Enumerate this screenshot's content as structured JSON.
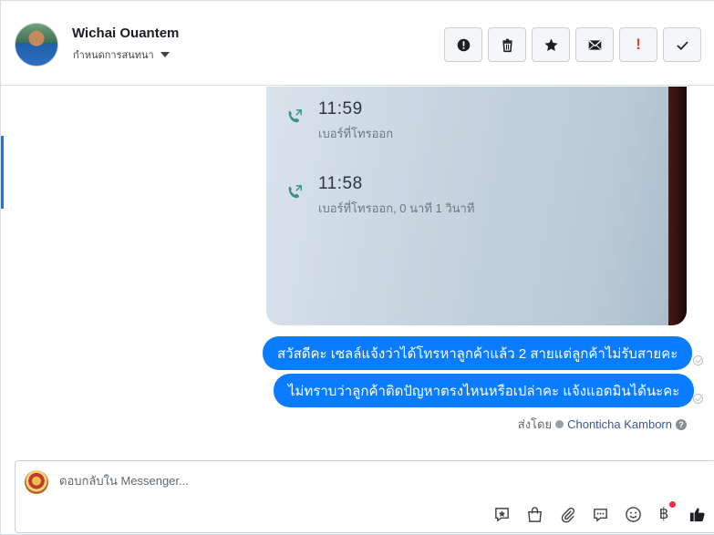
{
  "header": {
    "contact_name": "Wichai Ouantem",
    "assign_label": "กำหนดการสนทนา",
    "toolbar": {
      "spam_icon": "alert-circle-icon",
      "delete_icon": "trash-icon",
      "star_icon": "star-icon",
      "mail_icon": "envelope-icon",
      "important_label": "!",
      "done_icon": "check-icon"
    }
  },
  "photo": {
    "calls": [
      {
        "time": "11:59",
        "desc": "เบอร์ที่โทรออก"
      },
      {
        "time": "11:58",
        "desc": "เบอร์ที่โทรออก, 0 นาที 1 วินาที"
      }
    ]
  },
  "messages": [
    {
      "text": "สวัสดีคะ เซลล์แจ้งว่าได้โทรหาลูกค้าแล้ว 2 สายแต่ลูกค้าไม่รับสายคะ"
    },
    {
      "text": "ไม่ทราบว่าลูกค้าติดปัญหาตรงไหนหรือเปล่าคะ แจ้งแอดมินได้นะคะ"
    }
  ],
  "sent_by": {
    "prefix": "ส่งโดย",
    "sender": "Chonticha Kamborn",
    "help_icon": "?"
  },
  "composer": {
    "placeholder": "ตอบกลับใน Messenger...",
    "baht_symbol": "฿",
    "icons": [
      "saved-reply-icon",
      "shop-bag-icon",
      "paperclip-icon",
      "chat-bubble-icon",
      "emoji-icon",
      "payment-baht-icon",
      "thumbs-up-icon"
    ]
  },
  "colors": {
    "bubble": "#0a7cff",
    "accent": "#1877f2",
    "important": "#e0452e",
    "notification_dot": "#f02849"
  }
}
